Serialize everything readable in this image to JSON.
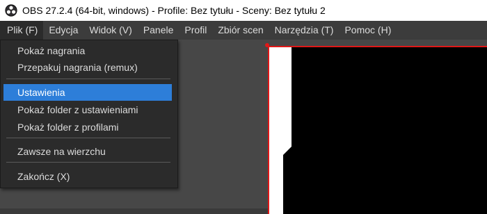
{
  "window": {
    "title": "OBS 27.2.4 (64-bit, windows) - Profile: Bez tytułu - Sceny: Bez tytułu 2",
    "logo_icon": "obs-logo-icon"
  },
  "menubar": {
    "items": [
      "Plik (F)",
      "Edycja",
      "Widok (V)",
      "Panele",
      "Profil",
      "Zbiór scen",
      "Narzędzia (T)",
      "Pomoc (H)"
    ],
    "open_item": "Plik (F)"
  },
  "file_menu": {
    "items": [
      "Pokaż nagrania",
      "Przepakuj nagrania (remux)",
      "Ustawienia",
      "Pokaż folder z ustawieniami",
      "Pokaż folder z profilami",
      "Zawsze na wierzchu",
      "Zakończ (X)"
    ],
    "selected": "Ustawienia"
  },
  "colors": {
    "selection": "#2d7ed9",
    "preview_border": "#e01818",
    "menu_bg": "#2b2b2b"
  }
}
